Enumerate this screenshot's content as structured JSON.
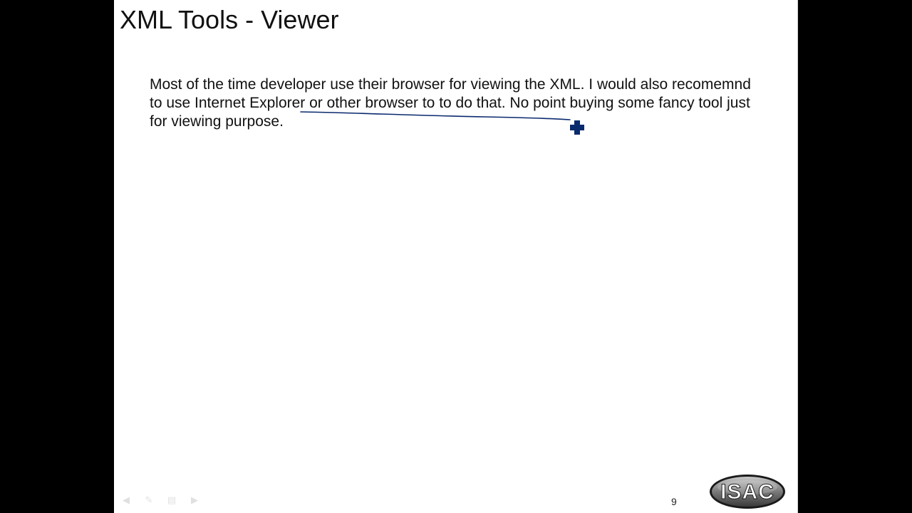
{
  "slide": {
    "title": "XML Tools - Viewer",
    "body": "Most of the time developer use their browser for viewing the XML. I would also recomemnd to use Internet Explorer or other browser to to do that. No point buying some fancy tool just for viewing purpose.",
    "page_number": "9",
    "logo_text": "ISAC"
  },
  "controls": {
    "prev": "◀",
    "pen": "✎",
    "menu": "▤",
    "next": "▶"
  },
  "colors": {
    "background": "#000000",
    "slide": "#ffffff",
    "text": "#111111",
    "ink": "#0a2a6e",
    "cursor": "#0a2a6e"
  },
  "icons": {
    "cursor": "pen-cross-icon",
    "prev": "previous-slide-icon",
    "pen": "pen-tool-icon",
    "menu": "slide-menu-icon",
    "next": "next-slide-icon"
  }
}
